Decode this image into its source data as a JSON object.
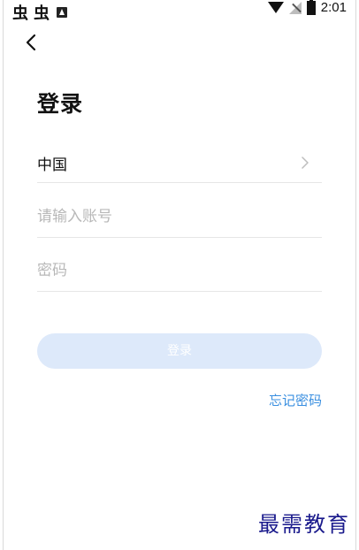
{
  "status_bar": {
    "time": "2:01",
    "left_icons": [
      "app-notification-icon",
      "app-notification-icon",
      "download-icon"
    ],
    "left_glyph": "虫"
  },
  "header": {
    "back_icon": "chevron-left-icon"
  },
  "page": {
    "title": "登录"
  },
  "form": {
    "country": "中国",
    "account_placeholder": "请输入账号",
    "password_placeholder": "密码"
  },
  "actions": {
    "login_label": "登录",
    "forgot_password": "忘记密码"
  },
  "watermark": {
    "text": "最需教育"
  },
  "colors": {
    "login_button_bg": "#dde9fa",
    "link": "#3a8fe0",
    "placeholder": "#b8b8b8",
    "watermark": "#1a1a8c"
  }
}
